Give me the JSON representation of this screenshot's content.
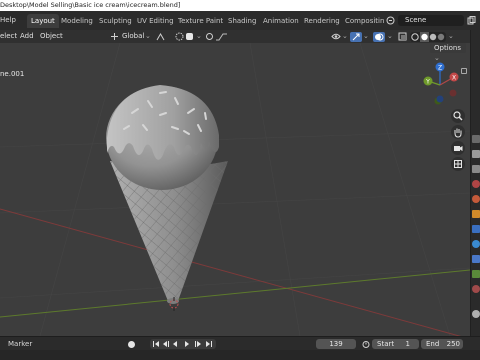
{
  "window": {
    "title": "Desktop\\Model Selling\\Basic ice cream\\icecream.blend]"
  },
  "menubar": {
    "help": "Help",
    "workspaces": [
      {
        "label": "Layout",
        "active": true
      },
      {
        "label": "Modeling"
      },
      {
        "label": "Sculpting"
      },
      {
        "label": "UV Editing"
      },
      {
        "label": "Texture Paint"
      },
      {
        "label": "Shading"
      },
      {
        "label": "Animation"
      },
      {
        "label": "Rendering"
      },
      {
        "label": "Compositin"
      }
    ],
    "scene": "Scene"
  },
  "header": {
    "menus": [
      "elect",
      "Add",
      "Object"
    ],
    "transform_orientation": "Global",
    "options": "Options"
  },
  "viewport": {
    "object_info": "ne.001",
    "gizmo": {
      "z": "Z",
      "y": "Y",
      "x": "X"
    },
    "colors": {
      "background": "#3d3d3d",
      "model": "#8c8c8c",
      "x_axis": "#8a3a3a",
      "y_axis": "#6a8a2a",
      "z_axis": "#2f6fd0"
    }
  },
  "timeline": {
    "marker": "Marker",
    "current_frame": "139",
    "start_label": "Start",
    "start_value": "1",
    "end_label": "End",
    "end_value": "250"
  }
}
